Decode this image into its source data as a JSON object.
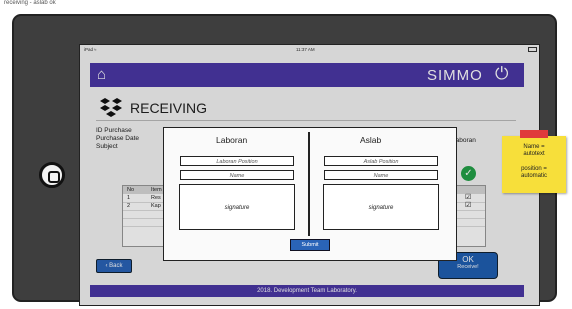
{
  "caption": "receiving - aslab ok",
  "statusbar": {
    "left": "iPad",
    "time": "11:37 AM"
  },
  "appbar": {
    "title": "SIMMO"
  },
  "page": {
    "title": "RECEIVING"
  },
  "meta": {
    "id_label": "ID Purchase",
    "date_label": "Purchase Date",
    "subject_label": "Subject",
    "right_label": "Laboran"
  },
  "table": {
    "headers": [
      "No",
      "Item"
    ],
    "rows": [
      {
        "no": "1",
        "item": "Res"
      },
      {
        "no": "2",
        "item": "Kap"
      }
    ]
  },
  "modal": {
    "laboran": {
      "title": "Laboran",
      "position_placeholder": "Laboran Position",
      "name_placeholder": "Name",
      "signature": "signature"
    },
    "aslab": {
      "title": "Aslab",
      "position_placeholder": "Aslab Position",
      "name_placeholder": "Name",
      "signature": "signature"
    },
    "submit": "Submit"
  },
  "buttons": {
    "back": "Back",
    "ok": "OK",
    "ok_sub": "Receive!"
  },
  "footer": "2018. Development Team Laboratory.",
  "sticky": {
    "line1": "Name =",
    "line2": "autotext",
    "line3": "position =",
    "line4": "automatic"
  },
  "colors": {
    "brand": "#4a37a6",
    "button": "#2a64b8",
    "success": "#24a148",
    "sticky": "#f7df3a"
  }
}
